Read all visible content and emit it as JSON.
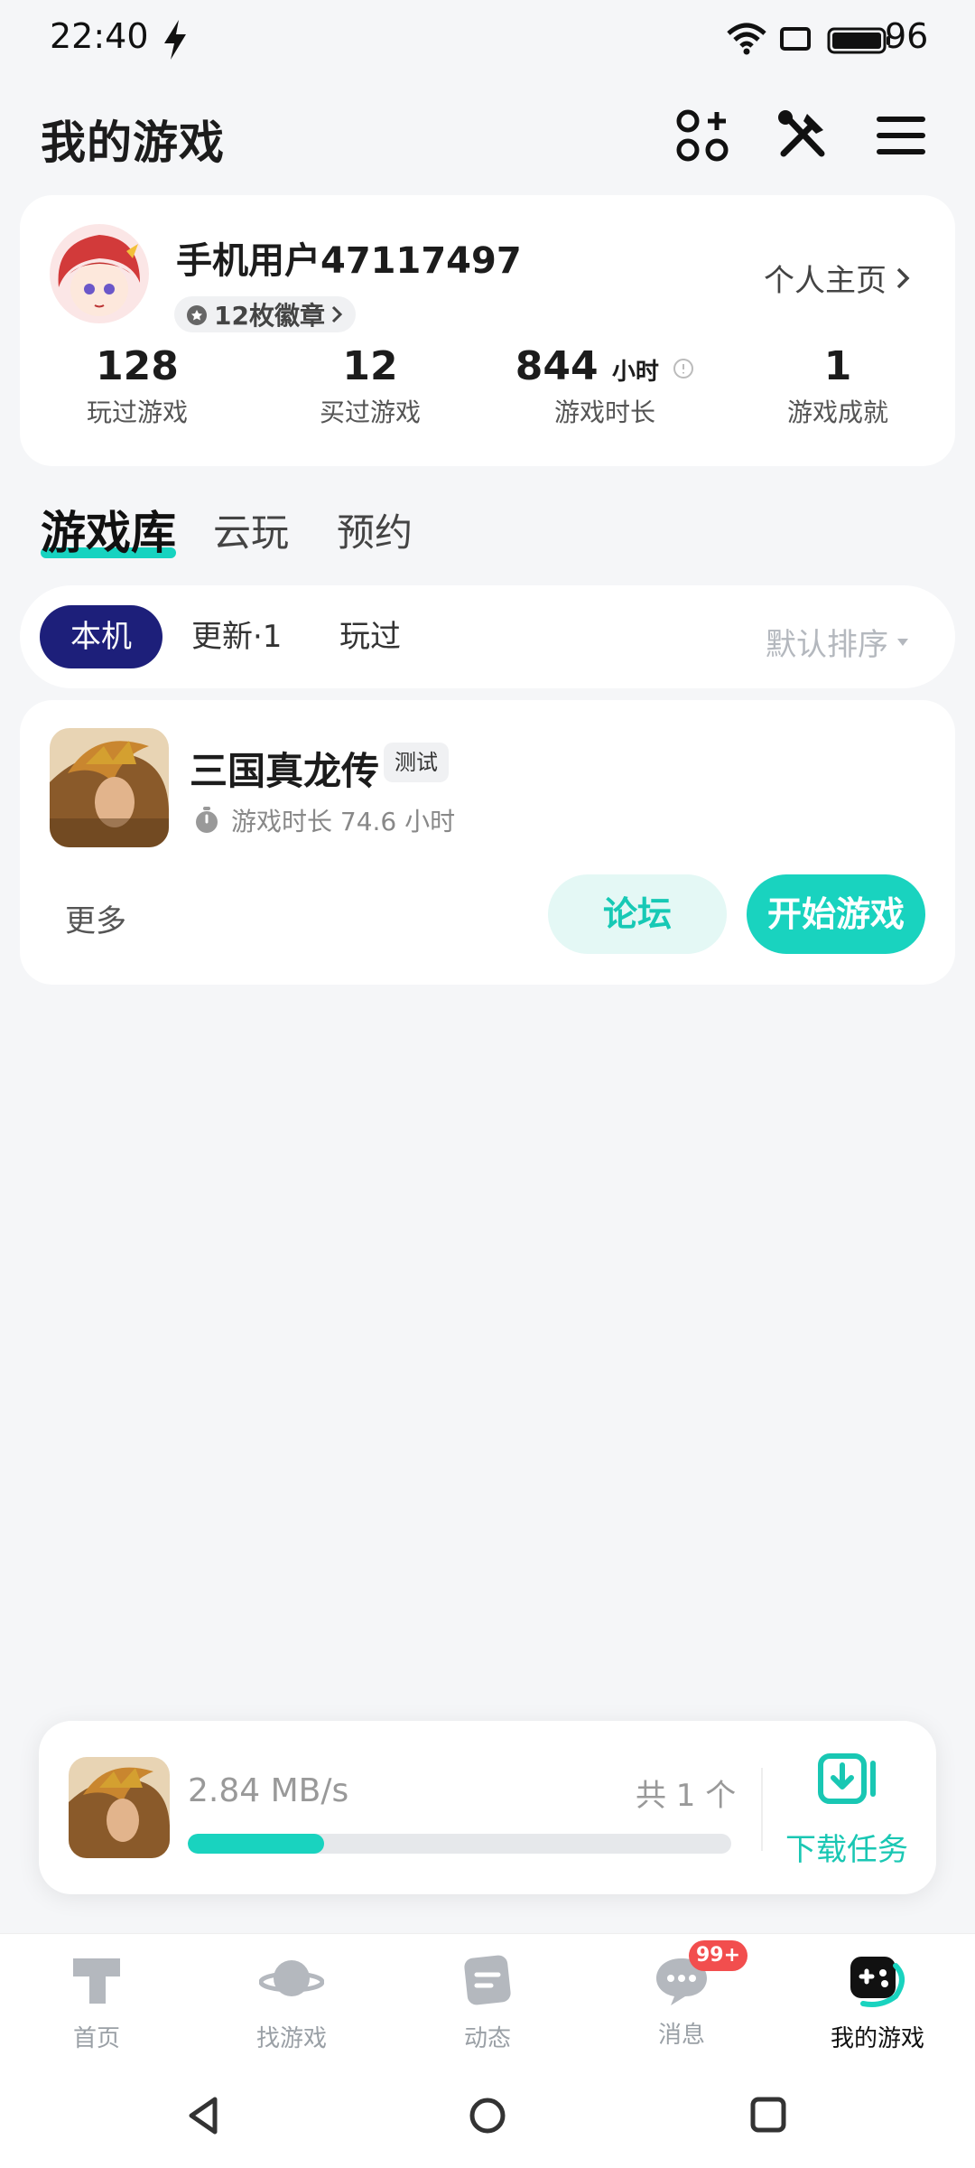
{
  "status_bar": {
    "time": "22:40",
    "battery": "96"
  },
  "header": {
    "title": "我的游戏"
  },
  "profile": {
    "username": "手机用户47117497",
    "badges": "12枚徽章",
    "home_link": "个人主页",
    "stats": [
      {
        "value": "128",
        "unit": "",
        "label": "玩过游戏"
      },
      {
        "value": "12",
        "unit": "",
        "label": "买过游戏"
      },
      {
        "value": "844",
        "unit": "小时",
        "label": "游戏时长"
      },
      {
        "value": "1",
        "unit": "",
        "label": "游戏成就"
      }
    ]
  },
  "library_tabs": [
    "游戏库",
    "云玩",
    "预约"
  ],
  "filters": {
    "chips": [
      "本机",
      "更新·1",
      "玩过"
    ],
    "sort": "默认排序"
  },
  "game": {
    "name": "三国真龙传",
    "tag": "测试",
    "playtime": "游戏时长 74.6 小时",
    "more": "更多",
    "forum_button": "论坛",
    "start_button": "开始游戏"
  },
  "download": {
    "speed": "2.84 MB/s",
    "count": "共 1 个",
    "progress": 0.25,
    "task_label": "下载任务"
  },
  "bottom_nav": {
    "items": [
      "首页",
      "找游戏",
      "动态",
      "消息",
      "我的游戏"
    ],
    "message_badge": "99+"
  },
  "colors": {
    "accent": "#19d3bf",
    "chip_active": "#1d1f7a",
    "badge": "#f24e4e"
  }
}
